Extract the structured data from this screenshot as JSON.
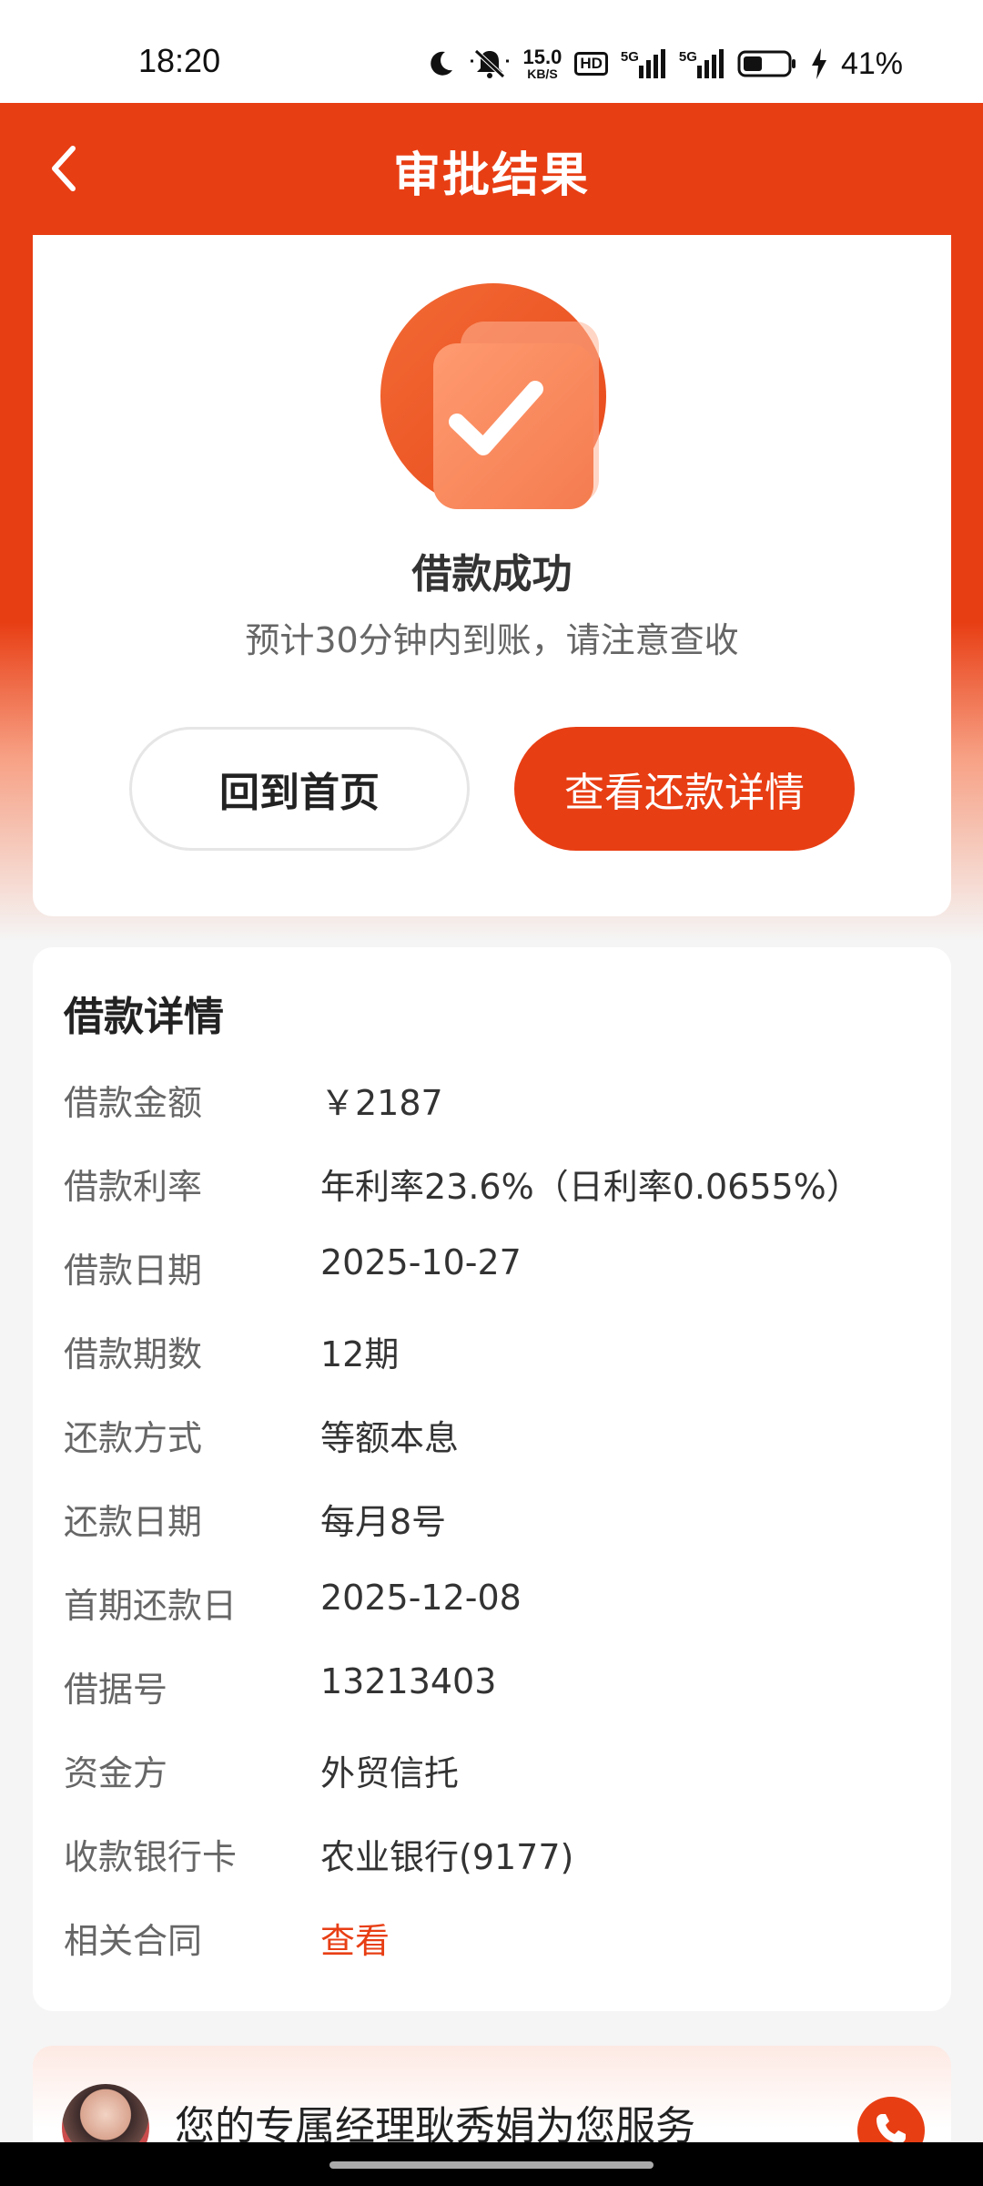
{
  "status_bar": {
    "time": "18:20",
    "net_speed_value": "15.0",
    "net_speed_unit": "KB/S",
    "hd_label": "HD",
    "signal1_label": "5G",
    "signal2_label": "5G",
    "battery_percent": "41%",
    "icons": [
      "moon-icon",
      "mute-bell-icon",
      "signal-icon",
      "battery-icon",
      "charging-icon"
    ]
  },
  "header": {
    "title": "审批结果",
    "back_icon": "chevron-left-icon",
    "background_color": "#e83e14"
  },
  "result": {
    "icon": "check-badge-icon",
    "title": "借款成功",
    "subtitle": "预计30分钟内到账，请注意查收",
    "home_button": "回到首页",
    "detail_button": "查看还款详情",
    "accent_color": "#e83e14"
  },
  "details": {
    "title": "借款详情",
    "rows": [
      {
        "label": "借款金额",
        "value": "￥2187"
      },
      {
        "label": "借款利率",
        "value": "年利率23.6%（日利率0.0655%）"
      },
      {
        "label": "借款日期",
        "value": "2025-10-27"
      },
      {
        "label": "借款期数",
        "value": "12期"
      },
      {
        "label": "还款方式",
        "value": "等额本息"
      },
      {
        "label": "还款日期",
        "value": "每月8号"
      },
      {
        "label": "首期还款日",
        "value": "2025-12-08"
      },
      {
        "label": "借据号",
        "value": "13213403"
      },
      {
        "label": "资金方",
        "value": "外贸信托"
      },
      {
        "label": "收款银行卡",
        "value": "农业银行(9177)"
      },
      {
        "label": "相关合同",
        "value": "查看"
      }
    ]
  },
  "manager": {
    "text": "您的专属经理耿秀娟为您服务",
    "phone_icon": "phone-icon"
  }
}
